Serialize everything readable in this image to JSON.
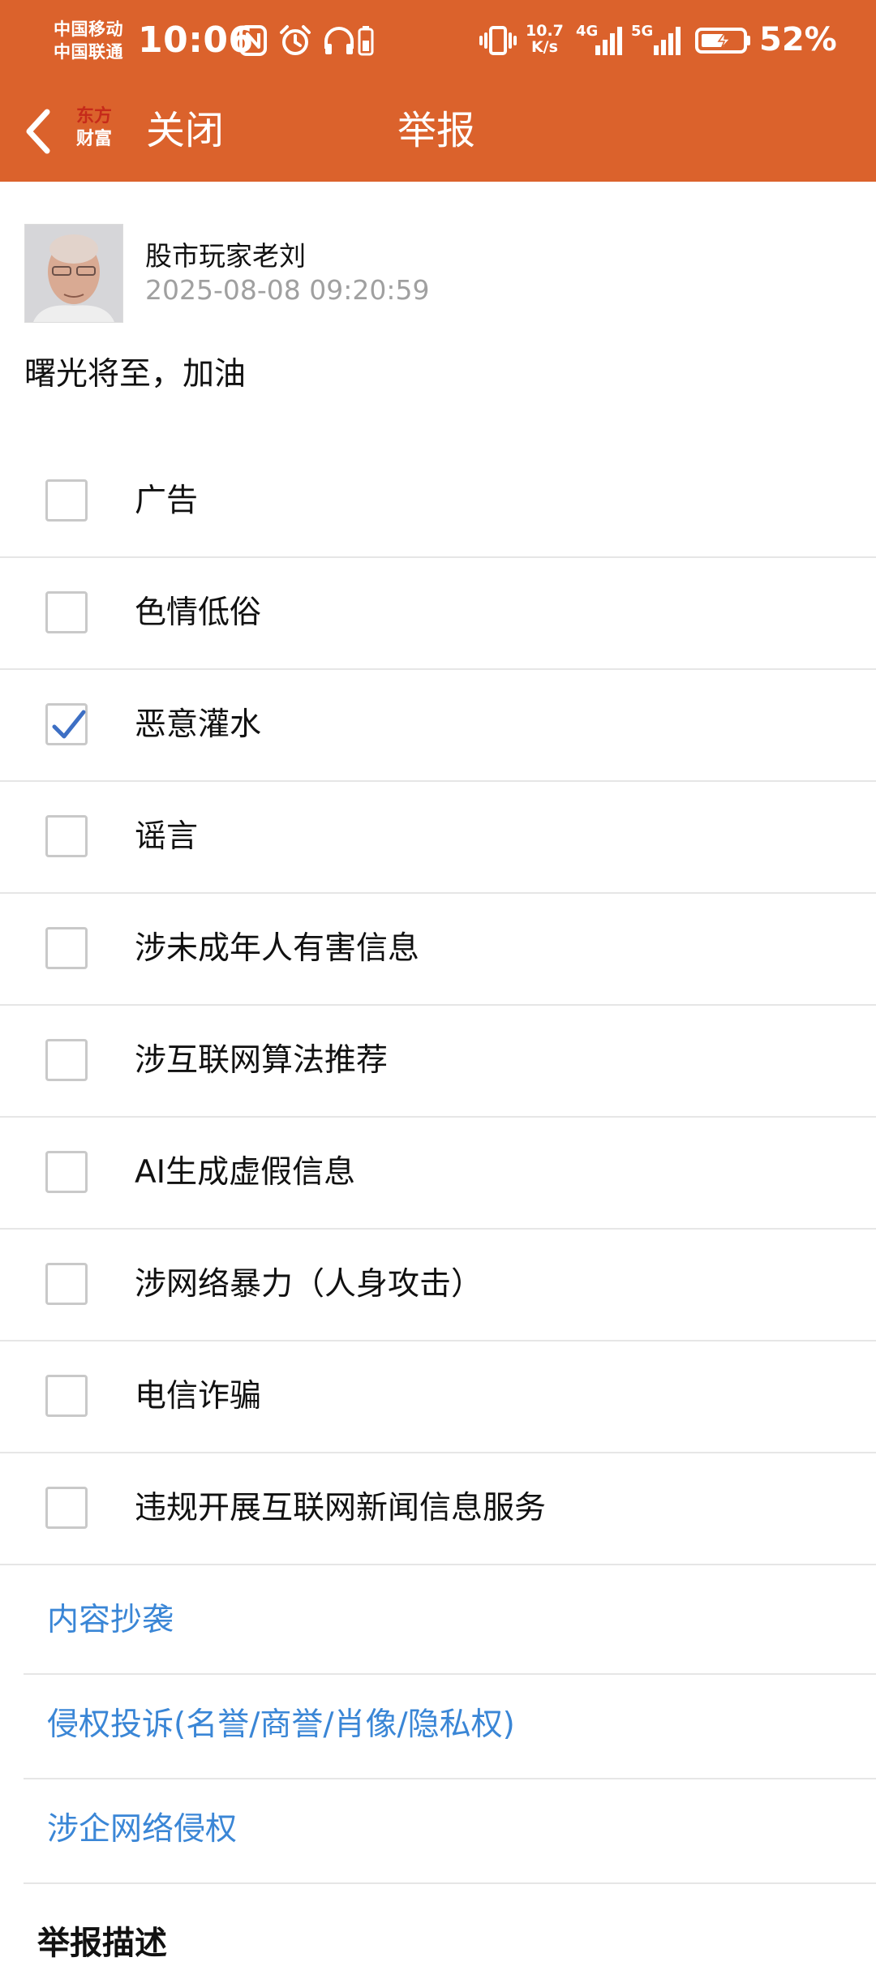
{
  "status_bar": {
    "carrier_1": "中国移动",
    "carrier_2": "中国联通",
    "time": "10:06",
    "net_speed_value": "10.7",
    "net_speed_unit": "K/s",
    "signal_1_label": "4G",
    "signal_2_label": "5G",
    "battery_percent": "52%"
  },
  "header": {
    "logo_line_1": "东方",
    "logo_line_2": "财富",
    "close_label": "关闭",
    "title": "举报"
  },
  "post": {
    "author": "股市玩家老刘",
    "timestamp": "2025-08-08 09:20:59",
    "content": "曙光将至，加油"
  },
  "report_options": [
    {
      "label": "广告",
      "checked": false
    },
    {
      "label": "色情低俗",
      "checked": false
    },
    {
      "label": "恶意灌水",
      "checked": true
    },
    {
      "label": "谣言",
      "checked": false
    },
    {
      "label": "涉未成年人有害信息",
      "checked": false
    },
    {
      "label": "涉互联网算法推荐",
      "checked": false
    },
    {
      "label": "AI生成虚假信息",
      "checked": false
    },
    {
      "label": "涉网络暴力（人身攻击）",
      "checked": false
    },
    {
      "label": "电信诈骗",
      "checked": false
    },
    {
      "label": "违规开展互联网新闻信息服务",
      "checked": false
    }
  ],
  "links": [
    {
      "label": "内容抄袭"
    },
    {
      "label": "侵权投诉(名誉/商誉/肖像/隐私权)"
    },
    {
      "label": "涉企网络侵权"
    }
  ],
  "description_heading": "举报描述",
  "colors": {
    "header_bg": "#db622c",
    "link": "#3a86d6",
    "check": "#3d6fc4"
  }
}
